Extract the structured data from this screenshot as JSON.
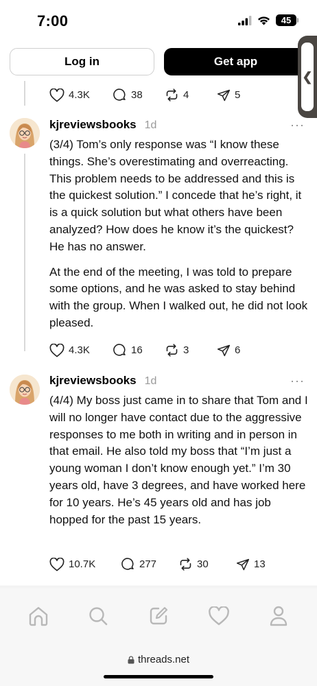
{
  "status_bar": {
    "time": "7:00",
    "battery": "45"
  },
  "auth": {
    "login_label": "Log in",
    "get_app_label": "Get app"
  },
  "side_tab": {
    "glyph": "❮"
  },
  "top_actions": {
    "likes": "4.3K",
    "replies": "38",
    "reposts": "4",
    "shares": "5"
  },
  "posts": [
    {
      "username": "kjreviewsbooks",
      "time": "1d",
      "more": "···",
      "paragraphs": [
        "(3/4) Tom’s only response was “I know these things. She’s overestimating and overreacting. This problem needs to be addressed and this is the quickest solution.” I concede that he’s right, it is a quick solution but what others have been analyzed? How does he know it’s the quickest? He has no answer.",
        "At the end of the meeting, I was told to prepare some options, and he was asked to stay behind with the group. When I walked out, he did not look pleased."
      ],
      "actions": {
        "likes": "4.3K",
        "replies": "16",
        "reposts": "3",
        "shares": "6"
      }
    },
    {
      "username": "kjreviewsbooks",
      "time": "1d",
      "more": "···",
      "paragraphs": [
        "(4/4) My boss just came in to share that Tom and I will no longer have contact due to the aggressive responses to me both in writing and in person in that email. He also told my boss that “I’m just a young woman I don’t know enough yet.” I’m 30 years old, have 3 degrees, and have worked here for 10 years. He’s 45 years old and has job hopped for the past 15 years."
      ],
      "actions": {
        "likes": "10.7K",
        "replies": "277",
        "reposts": "30",
        "shares": "13"
      }
    }
  ],
  "bottom_nav": [
    "home-icon",
    "search-icon",
    "compose-icon",
    "heart-icon",
    "profile-icon"
  ],
  "url_bar": {
    "url": "threads.net"
  }
}
